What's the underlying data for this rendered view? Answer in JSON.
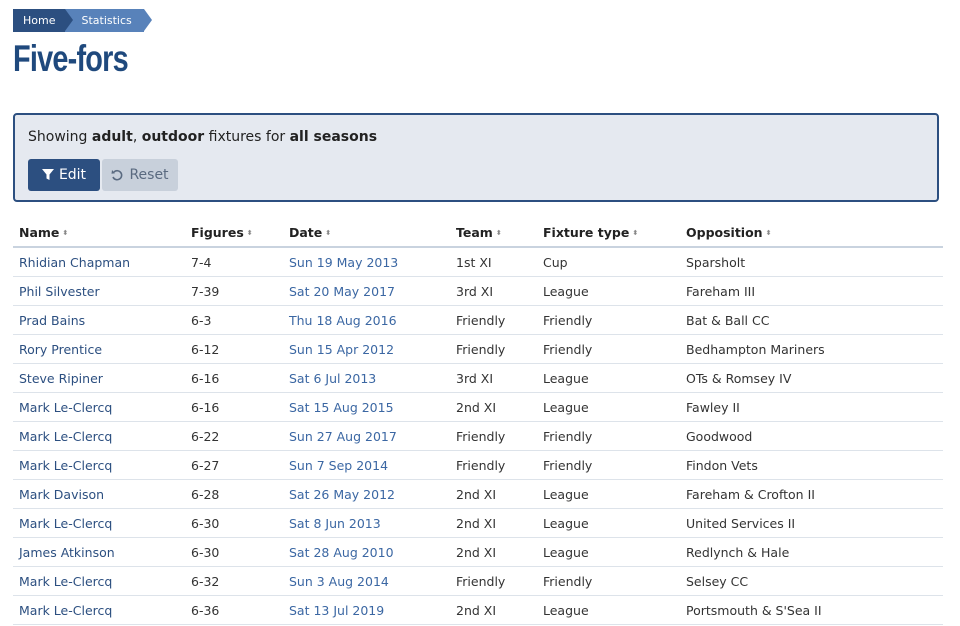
{
  "breadcrumb": {
    "home": "Home",
    "current": "Statistics"
  },
  "page": {
    "title": "Five-fors"
  },
  "filter": {
    "prefix": "Showing ",
    "age": "adult",
    "sep": ", ",
    "venue": "outdoor",
    "mid": " fixtures for ",
    "seasons": "all seasons",
    "edit_label": "Edit",
    "reset_label": "Reset"
  },
  "table": {
    "columns": [
      "Name",
      "Figures",
      "Date",
      "Team",
      "Fixture type",
      "Opposition"
    ],
    "rows": [
      [
        "Rhidian Chapman",
        "7-4",
        "Sun 19 May 2013",
        "1st XI",
        "Cup",
        "Sparsholt"
      ],
      [
        "Phil Silvester",
        "7-39",
        "Sat 20 May 2017",
        "3rd XI",
        "League",
        "Fareham III"
      ],
      [
        "Prad Bains",
        "6-3",
        "Thu 18 Aug 2016",
        "Friendly",
        "Friendly",
        "Bat & Ball CC"
      ],
      [
        "Rory Prentice",
        "6-12",
        "Sun 15 Apr 2012",
        "Friendly",
        "Friendly",
        "Bedhampton Mariners"
      ],
      [
        "Steve Ripiner",
        "6-16",
        "Sat 6 Jul 2013",
        "3rd XI",
        "League",
        "OTs & Romsey IV"
      ],
      [
        "Mark Le-Clercq",
        "6-16",
        "Sat 15 Aug 2015",
        "2nd XI",
        "League",
        "Fawley II"
      ],
      [
        "Mark Le-Clercq",
        "6-22",
        "Sun 27 Aug 2017",
        "Friendly",
        "Friendly",
        "Goodwood"
      ],
      [
        "Mark Le-Clercq",
        "6-27",
        "Sun 7 Sep 2014",
        "Friendly",
        "Friendly",
        "Findon Vets"
      ],
      [
        "Mark Davison",
        "6-28",
        "Sat 26 May 2012",
        "2nd XI",
        "League",
        "Fareham & Crofton II"
      ],
      [
        "Mark Le-Clercq",
        "6-30",
        "Sat 8 Jun 2013",
        "2nd XI",
        "League",
        "United Services II"
      ],
      [
        "James Atkinson",
        "6-30",
        "Sat 28 Aug 2010",
        "2nd XI",
        "League",
        "Redlynch & Hale"
      ],
      [
        "Mark Le-Clercq",
        "6-32",
        "Sun 3 Aug 2014",
        "Friendly",
        "Friendly",
        "Selsey CC"
      ],
      [
        "Mark Le-Clercq",
        "6-36",
        "Sat 13 Jul 2019",
        "2nd XI",
        "League",
        "Portsmouth & S'Sea II"
      ]
    ]
  },
  "colors": {
    "primary": "#2c4f80",
    "breadcrumb_light": "#5882ba",
    "panel_bg": "#e5e9f0"
  },
  "icons": {
    "edit": "filter-icon",
    "reset": "undo-icon",
    "sort": "sort-icon"
  }
}
